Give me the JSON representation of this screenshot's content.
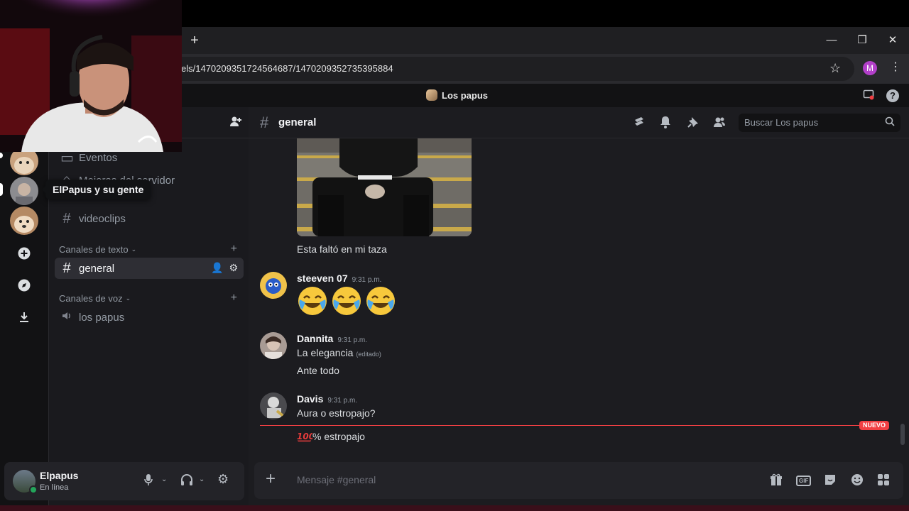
{
  "browser": {
    "new_tab": "+",
    "url": "els/1470209351724564687/1470209352735395884",
    "profile_initial": "M",
    "minimize": "—",
    "restore": "❐",
    "close": "✕"
  },
  "app": {
    "server_name": "Los papus",
    "help": "?"
  },
  "sidebar": {
    "partial_items": [
      "Eventos",
      "Mejoras del servidor"
    ],
    "videoclips": "videoclips",
    "text_category": "Canales de texto",
    "active_channel": "general",
    "voice_category": "Canales de voz",
    "voice_channel": "los papus"
  },
  "tooltip": "ElPapus y su gente",
  "user": {
    "name": "Elpapus",
    "status": "En línea"
  },
  "channel_header": {
    "name": "general",
    "search_placeholder": "Buscar Los papus"
  },
  "messages": {
    "caption": "Esta faltó en mi taza",
    "m1": {
      "author": "steeven 07",
      "time": "9:31 p.m.",
      "emoji_count": 3
    },
    "m2": {
      "author": "Dannita",
      "time": "9:31 p.m.",
      "line1": "La elegancia",
      "edited": "(editado)",
      "line2": "Ante todo"
    },
    "m3": {
      "author": "Davis",
      "time": "9:31 p.m.",
      "line1": "Aura o estropajo?",
      "line2_suffix": "% estropajo"
    }
  },
  "new_badge": "NUEVO",
  "composer": {
    "placeholder": "Mensaje #general",
    "gif": "GIF"
  },
  "colors": {
    "accent_new": "#f23f43",
    "online": "#23a55a",
    "profile": "#b23fc9"
  }
}
